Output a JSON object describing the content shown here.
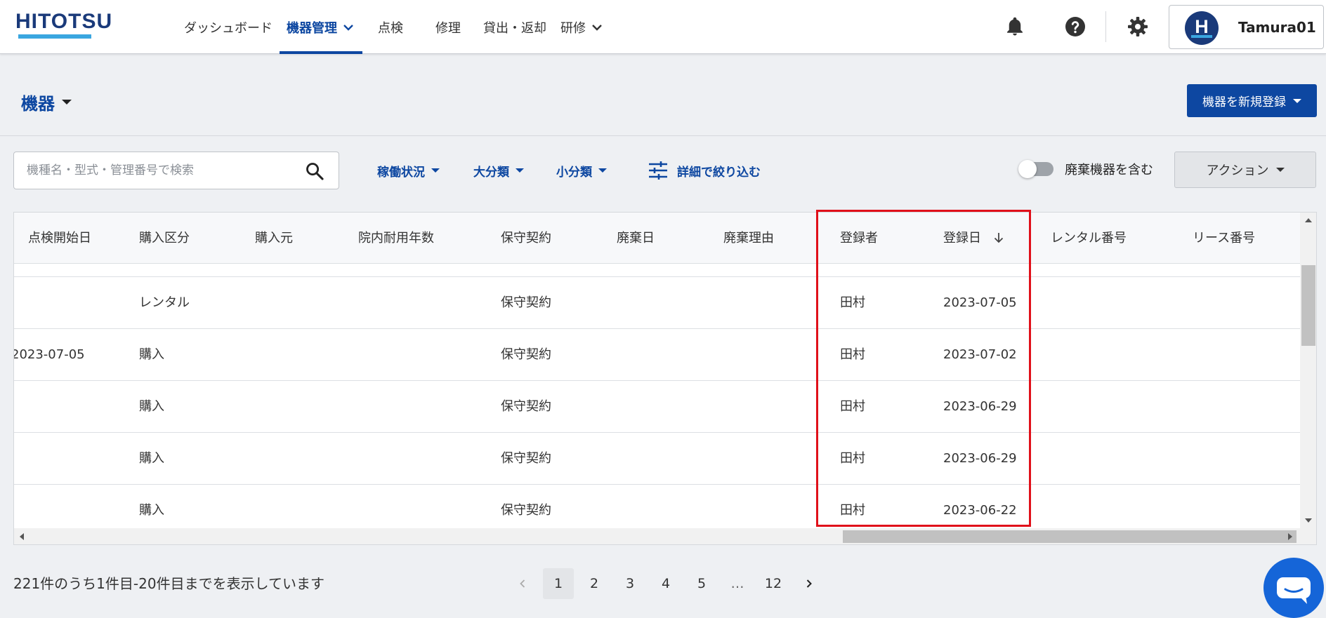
{
  "app": {
    "logo_text": "HITOTSU",
    "nav": [
      {
        "label": "ダッシュボード"
      },
      {
        "label": "機器管理"
      },
      {
        "label": "点検"
      },
      {
        "label": "修理"
      },
      {
        "label": "貸出・返却"
      },
      {
        "label": "研修"
      }
    ],
    "user": {
      "avatar_letter": "H",
      "name": "Tamura01"
    }
  },
  "page": {
    "title": "機器",
    "register_button": "機器を新規登録"
  },
  "filters": {
    "search_placeholder": "機種名・型式・管理番号で検索",
    "status": "稼働状況",
    "major_category": "大分類",
    "minor_category": "小分類",
    "detail": "詳細で絞り込む",
    "include_disposed": "廃棄機器を含む",
    "include_disposed_on": false,
    "action_button": "アクション"
  },
  "table": {
    "columns": [
      {
        "label": "点検開始日"
      },
      {
        "label": "購入区分"
      },
      {
        "label": "購入元"
      },
      {
        "label": "院内耐用年数"
      },
      {
        "label": "保守契約"
      },
      {
        "label": "廃棄日"
      },
      {
        "label": "廃棄理由"
      },
      {
        "label": "登録者"
      },
      {
        "label": "登録日"
      },
      {
        "label": "レンタル番号"
      },
      {
        "label": "リース番号"
      }
    ],
    "rows": [
      {
        "inspection_start": "",
        "purchase_type": "レンタル",
        "maintenance": "保守契約",
        "registrant": "田村",
        "registered": "2023-07-05"
      },
      {
        "inspection_start": "2023-07-05",
        "purchase_type": "購入",
        "maintenance": "保守契約",
        "registrant": "田村",
        "registered": "2023-07-02"
      },
      {
        "inspection_start": "",
        "purchase_type": "購入",
        "maintenance": "保守契約",
        "registrant": "田村",
        "registered": "2023-06-29"
      },
      {
        "inspection_start": "",
        "purchase_type": "購入",
        "maintenance": "保守契約",
        "registrant": "田村",
        "registered": "2023-06-29"
      },
      {
        "inspection_start": "",
        "purchase_type": "購入",
        "maintenance": "保守契約",
        "registrant": "田村",
        "registered": "2023-06-22"
      }
    ]
  },
  "footer": {
    "result_text": "221件のうち1件目-20件目までを表示しています",
    "pages": [
      "1",
      "2",
      "3",
      "4",
      "5",
      "…",
      "12"
    ],
    "current_page": "1"
  },
  "colors": {
    "brand": "#0d47a1",
    "logo_accent": "#3aa6e0",
    "highlight": "#e0101a",
    "chat": "#1565d8"
  }
}
